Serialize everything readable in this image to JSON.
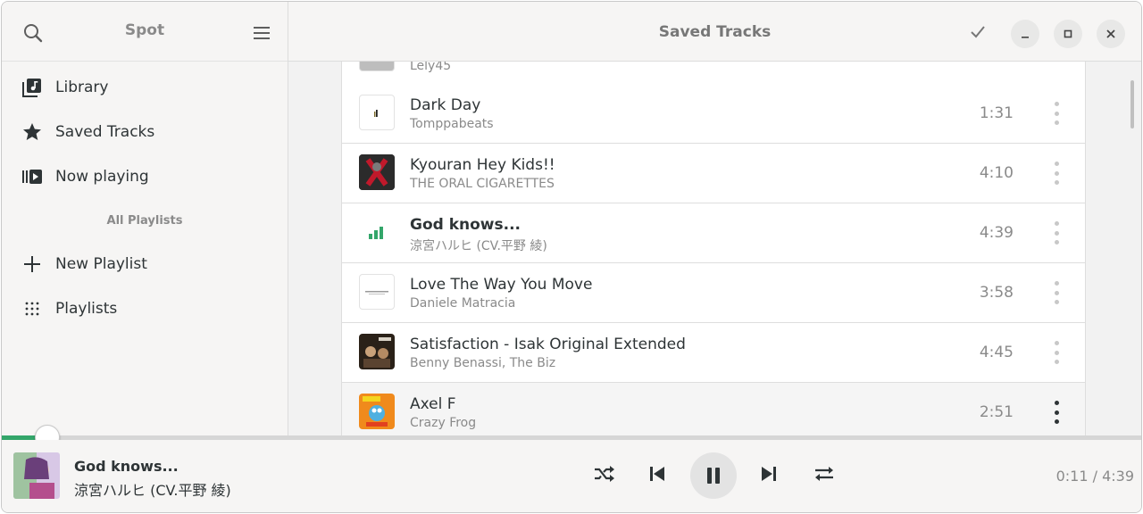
{
  "sidebar": {
    "title": "Spot",
    "items": [
      {
        "label": "Library",
        "icon": "library-icon"
      },
      {
        "label": "Saved Tracks",
        "icon": "star-icon"
      },
      {
        "label": "Now playing",
        "icon": "now-playing-icon"
      }
    ],
    "section_label": "All Playlists",
    "playlist_items": [
      {
        "label": "New Playlist",
        "icon": "plus-icon"
      },
      {
        "label": "Playlists",
        "icon": "grid-icon"
      }
    ]
  },
  "header": {
    "title": "Saved Tracks"
  },
  "tracks": [
    {
      "title": "",
      "artist": "Lely45",
      "duration": ""
    },
    {
      "title": "Dark Day",
      "artist": "Tomppabeats",
      "duration": "1:31"
    },
    {
      "title": "Kyouran Hey Kids!!",
      "artist": "THE ORAL CIGARETTES",
      "duration": "4:10"
    },
    {
      "title": "God knows...",
      "artist": "涼宮ハルヒ (CV.平野 綾)",
      "duration": "4:39",
      "playing": true
    },
    {
      "title": "Love The Way You Move",
      "artist": "Daniele Matracia",
      "duration": "3:58"
    },
    {
      "title": "Satisfaction - Isak Original Extended",
      "artist": "Benny Benassi, The Biz",
      "duration": "4:45"
    },
    {
      "title": "Axel F",
      "artist": "Crazy Frog",
      "duration": "2:51"
    }
  ],
  "player": {
    "title": "God knows...",
    "artist": "涼宮ハルヒ (CV.平野 綾)",
    "time": "0:11 / 4:39",
    "progress_fraction": 0.039
  },
  "colors": {
    "accent": "#33a66a",
    "text": "#2e3436",
    "muted": "#8a8a8a"
  }
}
